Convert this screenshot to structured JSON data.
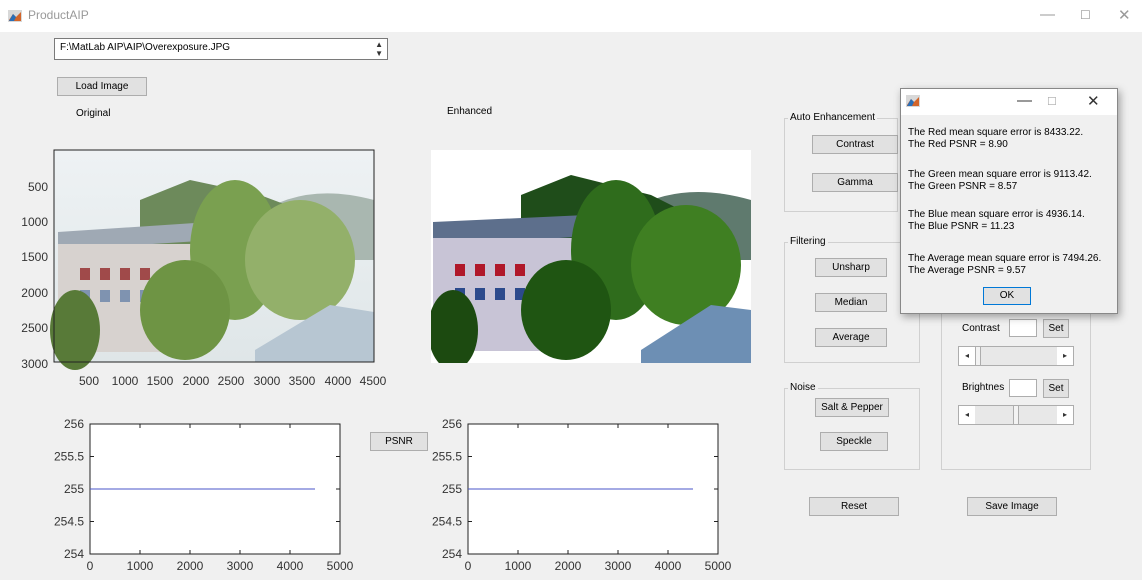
{
  "window": {
    "title": "ProductAIP",
    "minimize": "—",
    "maximize": "☐",
    "close": "✕"
  },
  "file": {
    "path": "F:\\MatLab AIP\\AIP\\Overexposure.JPG",
    "load_label": "Load Image"
  },
  "labels": {
    "original": "Original",
    "enhanced": "Enhanced"
  },
  "image_axes": {
    "y_ticks": [
      "500",
      "1000",
      "1500",
      "2000",
      "2500",
      "3000"
    ],
    "x_ticks": [
      "500",
      "1000",
      "1500",
      "2000",
      "2500",
      "3000",
      "3500",
      "4000",
      "4500"
    ]
  },
  "auto_enhancement": {
    "title": "Auto Enhancement",
    "contrast_label": "Contrast",
    "gamma_label": "Gamma"
  },
  "filtering": {
    "title": "Filtering",
    "unsharp_label": "Unsharp",
    "median_label": "Median",
    "average_label": "Average"
  },
  "noise": {
    "title": "Noise",
    "salt_pepper_label": "Salt & Pepper",
    "speckle_label": "Speckle"
  },
  "manual": {
    "contrast_label": "Contrast",
    "brightness_label": "Brightnes",
    "set_label": "Set",
    "contrast_slider_value": 0.0,
    "brightness_slider_value": 0.5
  },
  "psnr_label": "PSNR",
  "reset_label": "Reset",
  "save_label": "Save Image",
  "dialog": {
    "messages": [
      [
        "The Red mean square error is 8433.22.",
        "The Red PSNR = 8.90"
      ],
      [
        "The Green mean square error is 9113.42.",
        "The Green PSNR = 8.57"
      ],
      [
        "The Blue mean square error is 4936.14.",
        "The Blue PSNR = 11.23"
      ],
      [
        "The Average mean square error is 7494.26.",
        "The Average PSNR = 9.57"
      ]
    ],
    "ok_label": "OK"
  },
  "chart_data": [
    {
      "type": "line",
      "title": "",
      "x": [
        0,
        4500
      ],
      "series": [
        {
          "values": [
            255,
            255
          ]
        }
      ],
      "xlim": [
        0,
        5000
      ],
      "ylim": [
        254,
        256
      ],
      "x_ticks": [
        "0",
        "1000",
        "2000",
        "3000",
        "4000",
        "5000"
      ],
      "y_ticks": [
        "254",
        "254.5",
        "255",
        "255.5",
        "256"
      ],
      "grid": false,
      "color": "#4a55c8"
    },
    {
      "type": "line",
      "title": "",
      "x": [
        0,
        4500
      ],
      "series": [
        {
          "values": [
            255,
            255
          ]
        }
      ],
      "xlim": [
        0,
        5000
      ],
      "ylim": [
        254,
        256
      ],
      "x_ticks": [
        "0",
        "1000",
        "2000",
        "3000",
        "4000",
        "5000"
      ],
      "y_ticks": [
        "254",
        "254.5",
        "255",
        "255.5",
        "256"
      ],
      "grid": false,
      "color": "#4a55c8"
    }
  ]
}
